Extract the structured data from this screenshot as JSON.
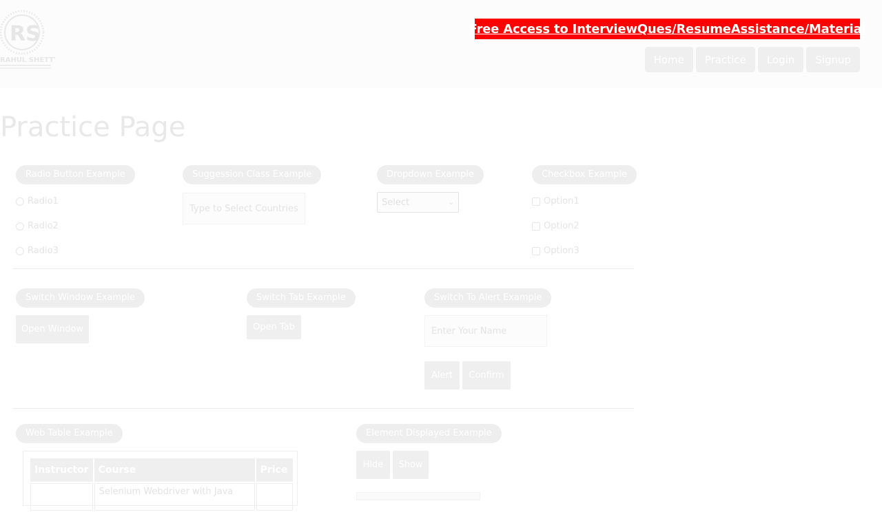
{
  "header": {
    "logo_text": "RAHUL SHETTY",
    "promo_link": "Free Access to InterviewQues/ResumeAssistance/Material",
    "nav": [
      {
        "label": "Home"
      },
      {
        "label": "Practice"
      },
      {
        "label": "Login"
      },
      {
        "label": "Signup"
      }
    ]
  },
  "page_title": "Practice Page",
  "radio_section": {
    "title": "Radio Button Example",
    "options": [
      "Radio1",
      "Radio2",
      "Radio3"
    ]
  },
  "suggestion_section": {
    "title": "Suggession Class Example",
    "placeholder": "Type to Select Countries"
  },
  "dropdown_section": {
    "title": "Dropdown Example",
    "selected": "Select"
  },
  "checkbox_section": {
    "title": "Checkbox Example",
    "options": [
      "Option1",
      "Option2",
      "Option3"
    ]
  },
  "switch_window": {
    "title": "Switch Window Example",
    "button": "Open Window"
  },
  "switch_tab": {
    "title": "Switch Tab Example",
    "button": "Open Tab"
  },
  "alert_section": {
    "title": "Switch To Alert Example",
    "placeholder": "Enter Your Name",
    "alert_button": "Alert",
    "confirm_button": "Confirm"
  },
  "web_table": {
    "title": "Web Table Example",
    "headers": [
      "Instructor",
      "Course",
      "Price"
    ],
    "rows": [
      [
        "",
        "Selenium Webdriver with Java",
        ""
      ]
    ]
  },
  "element_displayed": {
    "title": "Element Displayed Example",
    "hide_button": "Hide",
    "show_button": "Show"
  }
}
